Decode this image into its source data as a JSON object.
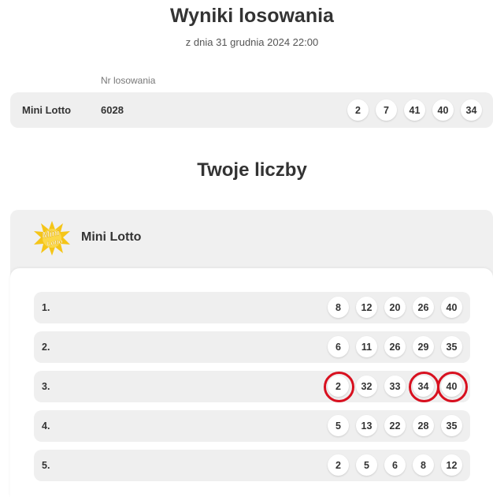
{
  "header": {
    "title": "Wyniki losowania",
    "subtitle": "z dnia 31 grudnia 2024 22:00"
  },
  "results": {
    "column_label": "Nr losowania",
    "game": "Mini Lotto",
    "draw_number": "6028",
    "numbers": [
      "2",
      "7",
      "41",
      "40",
      "34"
    ]
  },
  "your_numbers": {
    "title": "Twoje liczby",
    "card": {
      "game_name": "Mini Lotto",
      "logo_text_top": "Mini",
      "logo_text_bottom": "Lotto",
      "logo_icon": "mini-lotto-logo",
      "bets": [
        {
          "index": "1.",
          "numbers": [
            "8",
            "12",
            "20",
            "26",
            "40"
          ],
          "hits": []
        },
        {
          "index": "2.",
          "numbers": [
            "6",
            "11",
            "26",
            "29",
            "35"
          ],
          "hits": []
        },
        {
          "index": "3.",
          "numbers": [
            "2",
            "32",
            "33",
            "34",
            "40"
          ],
          "hits": [
            "2",
            "34",
            "40"
          ]
        },
        {
          "index": "4.",
          "numbers": [
            "5",
            "13",
            "22",
            "28",
            "35"
          ],
          "hits": []
        },
        {
          "index": "5.",
          "numbers": [
            "2",
            "5",
            "6",
            "8",
            "12"
          ],
          "hits": []
        }
      ]
    }
  },
  "colors": {
    "hit_circle": "#d8101f",
    "row_background": "#efefef",
    "logo_yellow": "#f5c518"
  }
}
